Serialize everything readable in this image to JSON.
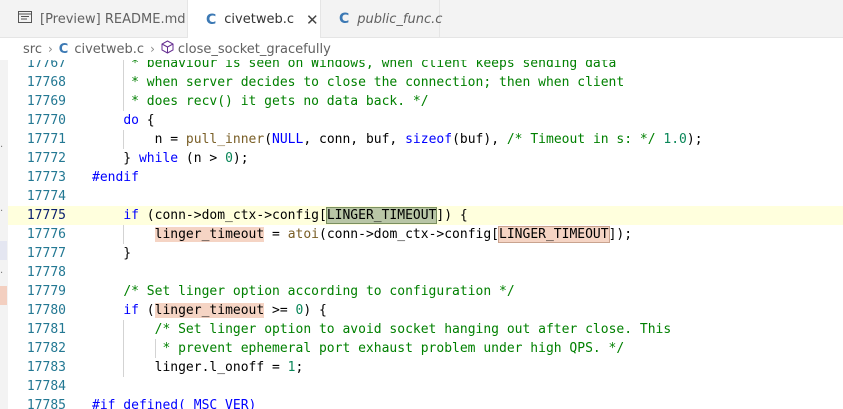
{
  "tabs": [
    {
      "label": "[Preview] README.md",
      "icon": "preview-icon",
      "active": false
    },
    {
      "label": "civetweb.c",
      "icon": "c-file-icon",
      "active": true,
      "close": "✕"
    },
    {
      "label": "public_func.c",
      "icon": "c-file-icon",
      "active": false
    }
  ],
  "breadcrumb": {
    "folder": "src",
    "file": "civetweb.c",
    "symbol": "close_socket_gracefully",
    "separator": "›"
  },
  "editor": {
    "current_line": "17775",
    "lines": [
      {
        "n": "17767",
        "tokens": [
          {
            "t": "     * behaviour is seen on Windows, when client keeps sending data",
            "c": "cm"
          }
        ]
      },
      {
        "n": "17768",
        "tokens": [
          {
            "t": "     * when server decides to close the connection; then when client",
            "c": "cm"
          }
        ]
      },
      {
        "n": "17769",
        "tokens": [
          {
            "t": "     * does recv() it gets no data back. */",
            "c": "cm"
          }
        ]
      },
      {
        "n": "17770",
        "tokens": [
          {
            "t": "    "
          },
          {
            "t": "do",
            "c": "kw"
          },
          {
            "t": " {"
          }
        ]
      },
      {
        "n": "17771",
        "tokens": [
          {
            "t": "        n = "
          },
          {
            "t": "pull_inner",
            "c": "fn"
          },
          {
            "t": "("
          },
          {
            "t": "NULL",
            "c": "kw"
          },
          {
            "t": ", conn, buf, "
          },
          {
            "t": "sizeof",
            "c": "kw"
          },
          {
            "t": "(buf), "
          },
          {
            "t": "/* Timeout in s: */",
            "c": "cm"
          },
          {
            "t": " "
          },
          {
            "t": "1.0",
            "c": "num"
          },
          {
            "t": ");"
          }
        ]
      },
      {
        "n": "17772",
        "tokens": [
          {
            "t": "    } "
          },
          {
            "t": "while",
            "c": "kw"
          },
          {
            "t": " (n > "
          },
          {
            "t": "0",
            "c": "num"
          },
          {
            "t": ");"
          }
        ]
      },
      {
        "n": "17773",
        "tokens": [
          {
            "t": "#endif",
            "c": "pp"
          }
        ]
      },
      {
        "n": "17774",
        "tokens": []
      },
      {
        "n": "17775",
        "tokens": [
          {
            "t": "    "
          },
          {
            "t": "if",
            "c": "kw"
          },
          {
            "t": " (conn->dom_ctx->config["
          },
          {
            "t": "LINGER_TIMEOUT",
            "c": "hl2"
          },
          {
            "t": "]) {"
          }
        ]
      },
      {
        "n": "17776",
        "tokens": [
          {
            "t": "        "
          },
          {
            "t": "linger_timeout",
            "c": "hl"
          },
          {
            "t": " = "
          },
          {
            "t": "atoi",
            "c": "fn"
          },
          {
            "t": "(conn->dom_ctx->config["
          },
          {
            "t": "LINGER_TIMEOUT",
            "c": "hl3"
          },
          {
            "t": "]);"
          }
        ]
      },
      {
        "n": "17777",
        "tokens": [
          {
            "t": "    }"
          }
        ]
      },
      {
        "n": "17778",
        "tokens": []
      },
      {
        "n": "17779",
        "tokens": [
          {
            "t": "    "
          },
          {
            "t": "/* Set linger option according to configuration */",
            "c": "cm"
          }
        ]
      },
      {
        "n": "17780",
        "tokens": [
          {
            "t": "    "
          },
          {
            "t": "if",
            "c": "kw"
          },
          {
            "t": " ("
          },
          {
            "t": "linger_timeout",
            "c": "hl"
          },
          {
            "t": " >= "
          },
          {
            "t": "0",
            "c": "num"
          },
          {
            "t": ") {"
          }
        ]
      },
      {
        "n": "17781",
        "tokens": [
          {
            "t": "        "
          },
          {
            "t": "/* Set linger option to avoid socket hanging out after close. This",
            "c": "cm"
          }
        ]
      },
      {
        "n": "17782",
        "tokens": [
          {
            "t": "         * prevent ephemeral port exhaust problem under high QPS. */",
            "c": "cm"
          }
        ]
      },
      {
        "n": "17783",
        "tokens": [
          {
            "t": "        linger.l_onoff = "
          },
          {
            "t": "1",
            "c": "num"
          },
          {
            "t": ";"
          }
        ]
      },
      {
        "n": "17784",
        "tokens": []
      },
      {
        "n": "17785",
        "tokens": [
          {
            "t": "#if defined(_MSC_VER)",
            "c": "pp"
          }
        ]
      }
    ]
  },
  "colors": {
    "keyword": "#0000ff",
    "comment": "#008000",
    "function": "#795e26",
    "number": "#098658",
    "line_number": "#237893",
    "current_line_bg": "#ffffdd",
    "highlight": "#f5d4c4"
  }
}
